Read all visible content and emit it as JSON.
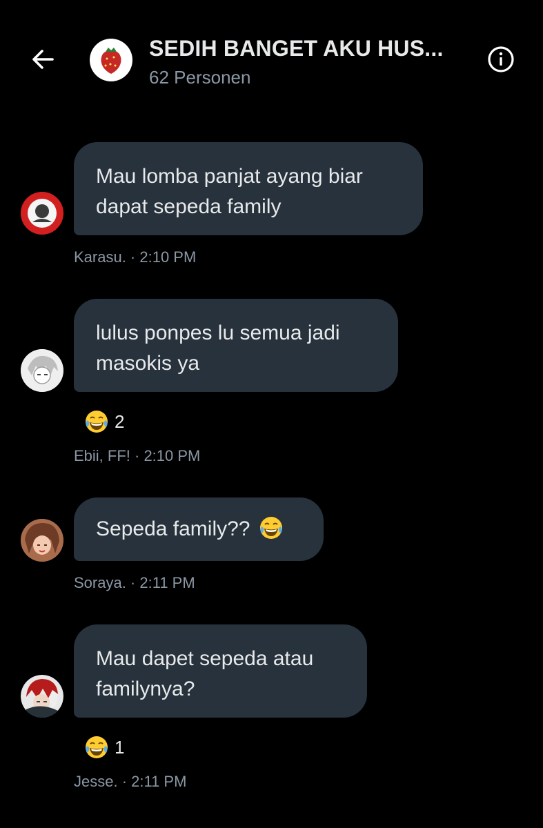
{
  "header": {
    "back_icon": "arrow-left-icon",
    "group_name": "SEDIH BANGET AKU HUS...",
    "member_count": "62 Personen",
    "info_icon": "info-circle-icon"
  },
  "messages": [
    {
      "line1": "Mau lomba panjat ayang biar",
      "line2": "dapat sepeda family",
      "meta": "Karasu. · 2:10 PM"
    },
    {
      "line1": "lulus ponpes lu semua jadi",
      "line2": "masokis ya",
      "reaction_count": "2",
      "reaction_icon": "tears-of-joy-emoji",
      "meta": "Ebii, FF! · 2:10 PM"
    },
    {
      "text": "Sepeda family??",
      "inline_icon": "tears-of-joy-emoji",
      "meta": "Soraya. · 2:11 PM"
    },
    {
      "line1": "Mau dapet sepeda atau",
      "line2": "familynya?",
      "reaction_count": "1",
      "reaction_icon": "tears-of-joy-emoji",
      "meta": "Jesse. · 2:11 PM"
    }
  ],
  "colors": {
    "background": "#000000",
    "bubble": "#27323c",
    "text": "#e7e9ea",
    "secondary_text": "#8b98a5"
  }
}
